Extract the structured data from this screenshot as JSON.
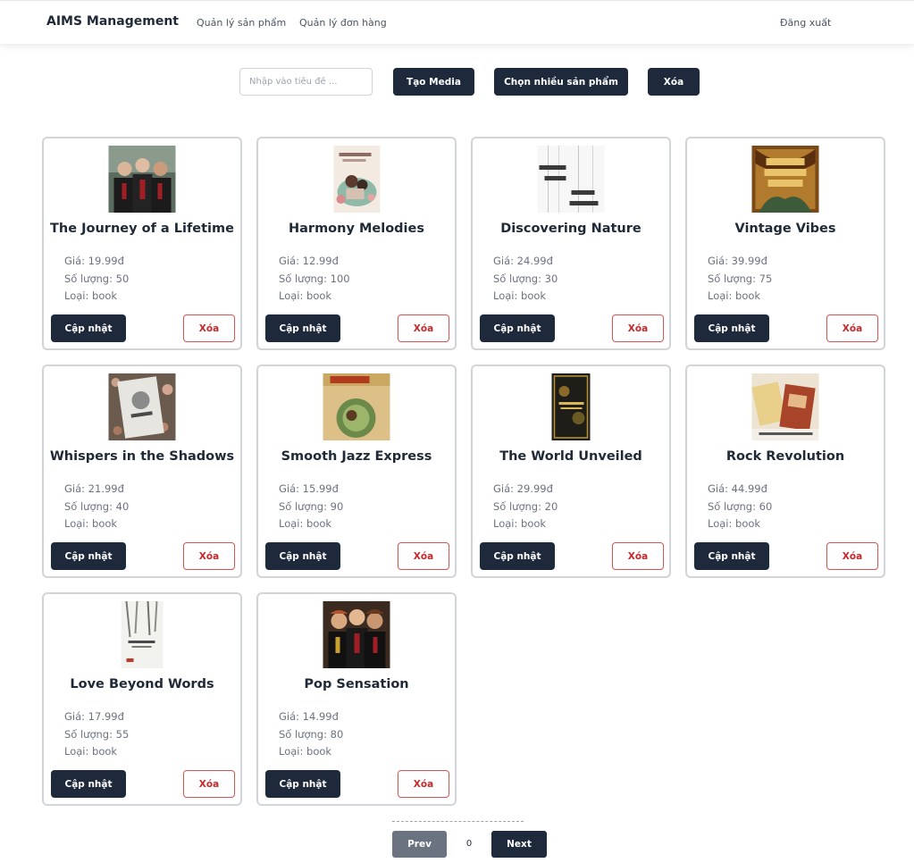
{
  "header": {
    "brand": "AIMS Management",
    "nav": {
      "products": "Quản lý sản phẩm",
      "orders": "Quản lý đơn hàng",
      "logout": "Đăng xuất"
    }
  },
  "toolbar": {
    "search_placeholder": "Nhập vào tiêu đề ...",
    "search_value": "",
    "create_label": "Tạo Media",
    "multi_select_label": "Chọn nhiều sản phẩm",
    "delete_label": "Xóa"
  },
  "products": [
    {
      "title": "The Journey of a Lifetime",
      "price": "Giá: 19.99đ",
      "quantity": "Số lượng: 50",
      "type": "Loại: book",
      "update_label": "Cập nhật",
      "delete_label": "Xóa",
      "cover": "photo-three-students"
    },
    {
      "title": "Harmony Melodies",
      "price": "Giá: 12.99đ",
      "quantity": "Số lượng: 100",
      "type": "Loại: book",
      "update_label": "Cập nhật",
      "delete_label": "Xóa",
      "cover": "book-cover-illustration-green"
    },
    {
      "title": "Discovering Nature",
      "price": "Giá: 24.99đ",
      "quantity": "Số lượng: 30",
      "type": "Loại: book",
      "update_label": "Cập nhật",
      "delete_label": "Xóa",
      "cover": "book-cover-white-text"
    },
    {
      "title": "Vintage Vibes",
      "price": "Giá: 39.99đ",
      "quantity": "Số lượng: 75",
      "type": "Loại: book",
      "update_label": "Cập nhật",
      "delete_label": "Xóa",
      "cover": "book-cover-gold-ornate"
    },
    {
      "title": "Whispers in the Shadows",
      "price": "Giá: 21.99đ",
      "quantity": "Số lượng: 40",
      "type": "Loại: book",
      "update_label": "Cập nhật",
      "delete_label": "Xóa",
      "cover": "book-cover-floral-gray"
    },
    {
      "title": "Smooth Jazz Express",
      "price": "Giá: 15.99đ",
      "quantity": "Số lượng: 90",
      "type": "Loại: book",
      "update_label": "Cập nhật",
      "delete_label": "Xóa",
      "cover": "book-cover-yellow-circle"
    },
    {
      "title": "The World Unveiled",
      "price": "Giá: 29.99đ",
      "quantity": "Số lượng: 20",
      "type": "Loại: book",
      "update_label": "Cập nhật",
      "delete_label": "Xóa",
      "cover": "book-cover-dark-gold"
    },
    {
      "title": "Rock Revolution",
      "price": "Giá: 44.99đ",
      "quantity": "Số lượng: 60",
      "type": "Loại: book",
      "update_label": "Cập nhật",
      "delete_label": "Xóa",
      "cover": "photo-books-on-table"
    },
    {
      "title": "Love Beyond Words",
      "price": "Giá: 17.99đ",
      "quantity": "Số lượng: 55",
      "type": "Loại: book",
      "update_label": "Cập nhật",
      "delete_label": "Xóa",
      "cover": "book-cover-snowy-forest"
    },
    {
      "title": "Pop Sensation",
      "price": "Giá: 14.99đ",
      "quantity": "Số lượng: 80",
      "type": "Loại: book",
      "update_label": "Cập nhật",
      "delete_label": "Xóa",
      "cover": "photo-three-students"
    }
  ],
  "pagination": {
    "prev_label": "Prev",
    "page": "0",
    "next_label": "Next"
  }
}
